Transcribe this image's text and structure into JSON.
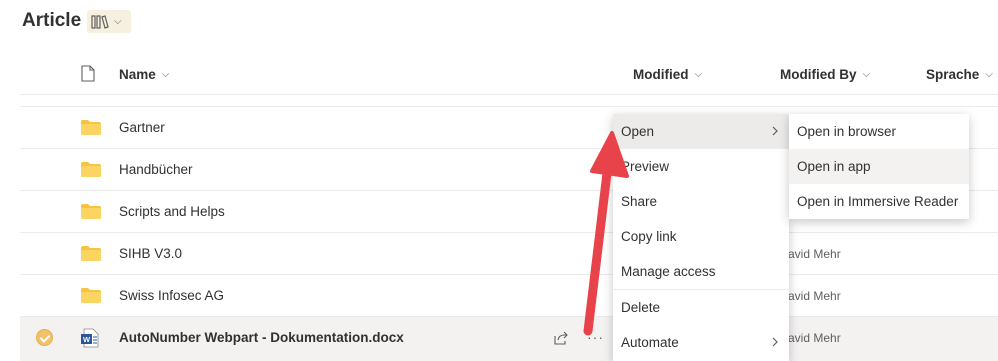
{
  "page": {
    "title": "Article"
  },
  "library_switch": {
    "icon": "library-books-icon"
  },
  "columns": {
    "name": "Name",
    "modified": "Modified",
    "modified_by": "Modified By",
    "sprache": "Sprache"
  },
  "rows": [
    {
      "name": "Gartner",
      "modified_by": ""
    },
    {
      "name": "Handbücher",
      "modified_by": ""
    },
    {
      "name": "Scripts and Helps",
      "modified_by": ""
    },
    {
      "name": "SIHB V3.0",
      "modified_by": "avid Mehr"
    },
    {
      "name": "Swiss Infosec AG",
      "modified_by": "avid Mehr"
    },
    {
      "name": "AutoNumber Webpart - Dokumentation.docx",
      "modified_by": "avid Mehr"
    }
  ],
  "context_menu": {
    "items": [
      "Open",
      "Preview",
      "Share",
      "Copy link",
      "Manage access",
      "Delete",
      "Automate"
    ]
  },
  "submenu": {
    "items": [
      "Open in browser",
      "Open in app",
      "Open in Immersive Reader"
    ]
  },
  "colors": {
    "folder": "#f8c43e",
    "arrow": "#e8424b",
    "word_blue": "#2b579a",
    "selection": "#f0c36b"
  }
}
